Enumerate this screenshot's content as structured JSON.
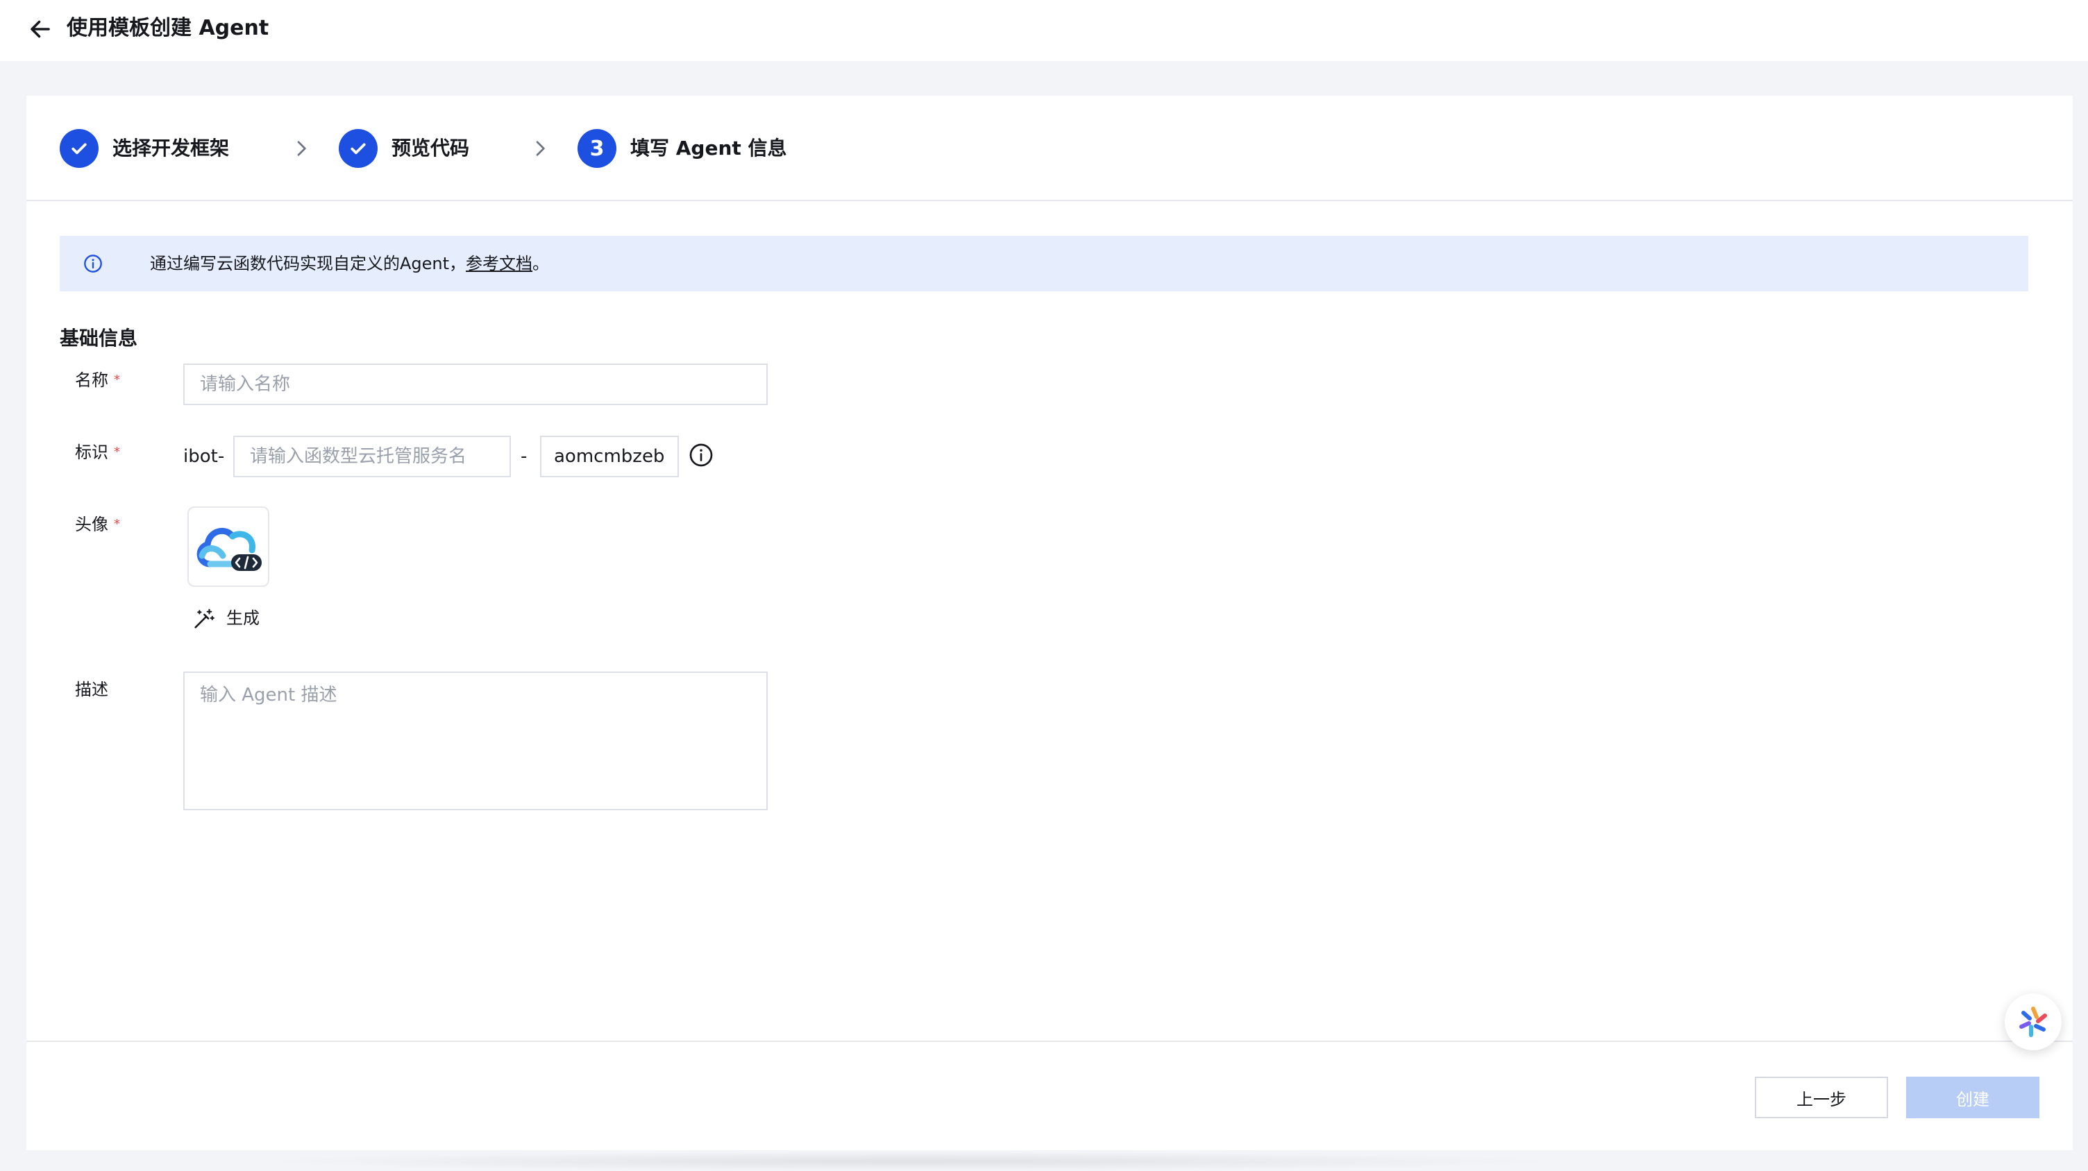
{
  "header": {
    "back_icon": "arrow-left-icon",
    "title": "使用模板创建 Agent"
  },
  "steps": [
    {
      "label": "选择开发框架",
      "state": "done",
      "icon": "check-icon"
    },
    {
      "label": "预览代码",
      "state": "done",
      "icon": "check-icon"
    },
    {
      "label": "填写 Agent 信息",
      "state": "current",
      "number": "3"
    }
  ],
  "notice": {
    "icon": "info-icon",
    "text": "通过编写云函数代码实现自定义的Agent，",
    "link": "参考文档",
    "suffix": "。"
  },
  "form": {
    "section_title": "基础信息",
    "name": {
      "label": "名称",
      "required": "*",
      "placeholder": "请输入名称",
      "value": ""
    },
    "identifier": {
      "label": "标识",
      "required": "*",
      "prefix": "ibot-",
      "placeholder": "请输入函数型云托管服务名",
      "separator": "-",
      "suffix_value": "aomcmbzeb"
    },
    "avatar": {
      "label": "头像",
      "required": "*",
      "image": "cloud-code-logo",
      "generate_label": "生成",
      "generate_icon": "magic-wand-icon"
    },
    "description": {
      "label": "描述",
      "placeholder": "输入 Agent 描述",
      "value": ""
    }
  },
  "footer": {
    "prev_label": "上一步",
    "create_label": "创建"
  },
  "colors": {
    "primary": "#1d4fe0",
    "notice_bg": "#e6edfd",
    "disabled_button": "#b8cdf6",
    "required": "#e54545"
  },
  "floating": {
    "icon": "assistant-icon"
  }
}
